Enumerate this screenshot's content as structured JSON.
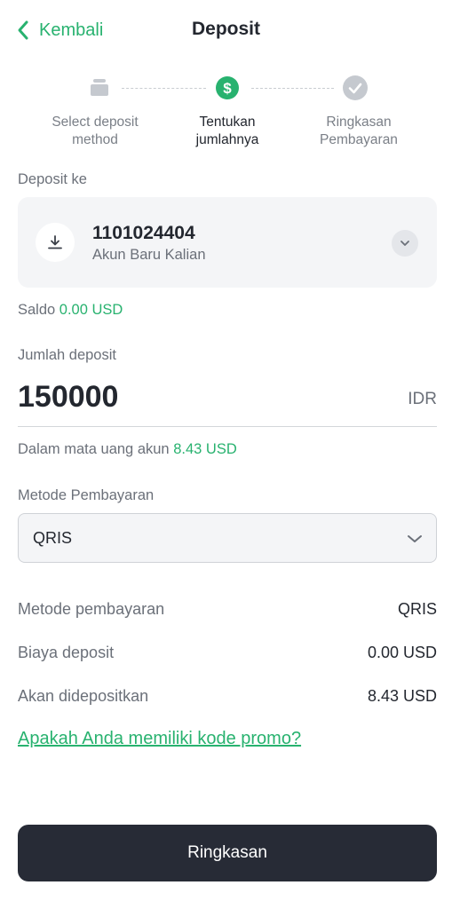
{
  "header": {
    "back_label": "Kembali",
    "title": "Deposit"
  },
  "stepper": {
    "steps": [
      {
        "label_line1": "Select deposit",
        "label_line2": "method",
        "state": "pending",
        "icon": "wallet-icon"
      },
      {
        "label_line1": "Tentukan",
        "label_line2": "jumlahnya",
        "state": "active",
        "icon": "dollar-icon"
      },
      {
        "label_line1": "Ringkasan",
        "label_line2": "Pembayaran",
        "state": "pending",
        "icon": "check-icon"
      }
    ]
  },
  "deposit_to": {
    "label": "Deposit ke",
    "account_number": "1101024404",
    "account_name": "Akun Baru Kalian"
  },
  "balance": {
    "label": "Saldo",
    "value": "0.00 USD"
  },
  "amount": {
    "label": "Jumlah deposit",
    "value": "150000",
    "currency": "IDR",
    "converted_label": "Dalam mata uang akun",
    "converted_value": "8.43 USD"
  },
  "payment_method": {
    "label": "Metode Pembayaran",
    "selected": "QRIS"
  },
  "summary": [
    {
      "label": "Metode pembayaran",
      "value": "QRIS"
    },
    {
      "label": "Biaya deposit",
      "value": "0.00 USD"
    },
    {
      "label": "Akan didepositkan",
      "value": "8.43 USD"
    }
  ],
  "promo_link": "Apakah Anda memiliki kode promo?",
  "submit_label": "Ringkasan",
  "colors": {
    "accent": "#28b26f",
    "button": "#272b36",
    "inactive_icon": "#c5c9cf"
  }
}
